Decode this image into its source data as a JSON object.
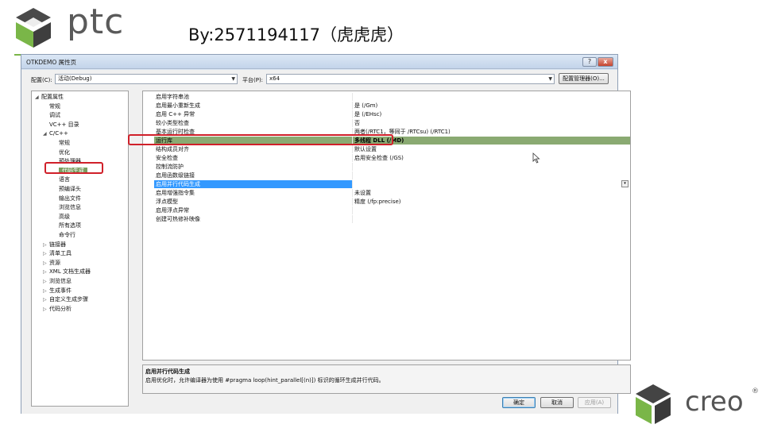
{
  "slide": {
    "byline": "By:2571194117（虎虎虎）",
    "brand_top": "ptc",
    "brand_bottom": "creo",
    "brand_bottom_mark": "®"
  },
  "window": {
    "title": "OTKDEMO 属性页",
    "help_label": "?",
    "close_label": "x"
  },
  "toolbar": {
    "config_label": "配置(C):",
    "config_value": "活动(Debug)",
    "platform_label": "平台(P):",
    "platform_value": "x64",
    "config_manager_label": "配置管理器(O)..."
  },
  "tree": {
    "items": [
      {
        "label": "配置属性",
        "toggle": "◢",
        "level": 0
      },
      {
        "label": "常规",
        "toggle": "",
        "level": 1
      },
      {
        "label": "调试",
        "toggle": "",
        "level": 1
      },
      {
        "label": "VC++ 目录",
        "toggle": "",
        "level": 1
      },
      {
        "label": "C/C++",
        "toggle": "◢",
        "level": 1
      },
      {
        "label": "常规",
        "toggle": "",
        "level": 2
      },
      {
        "label": "优化",
        "toggle": "",
        "level": 2
      },
      {
        "label": "预处理器",
        "toggle": "",
        "level": 2
      },
      {
        "label": "代码生成",
        "toggle": "",
        "level": 2
      },
      {
        "label": "语言",
        "toggle": "",
        "level": 2
      },
      {
        "label": "预编译头",
        "toggle": "",
        "level": 2
      },
      {
        "label": "输出文件",
        "toggle": "",
        "level": 2
      },
      {
        "label": "浏览信息",
        "toggle": "",
        "level": 2
      },
      {
        "label": "高级",
        "toggle": "",
        "level": 2
      },
      {
        "label": "所有选项",
        "toggle": "",
        "level": 2
      },
      {
        "label": "命令行",
        "toggle": "",
        "level": 2
      },
      {
        "label": "链接器",
        "toggle": "▷",
        "level": 1
      },
      {
        "label": "清单工具",
        "toggle": "▷",
        "level": 1
      },
      {
        "label": "资源",
        "toggle": "▷",
        "level": 1
      },
      {
        "label": "XML 文档生成器",
        "toggle": "▷",
        "level": 1
      },
      {
        "label": "浏览信息",
        "toggle": "▷",
        "level": 1
      },
      {
        "label": "生成事件",
        "toggle": "▷",
        "level": 1
      },
      {
        "label": "自定义生成步骤",
        "toggle": "▷",
        "level": 1
      },
      {
        "label": "代码分析",
        "toggle": "▷",
        "level": 1
      }
    ]
  },
  "properties": {
    "rows": [
      {
        "name": "启用字符串池",
        "value": ""
      },
      {
        "name": "启用最小重新生成",
        "value": "是 (/Gm)"
      },
      {
        "name": "启用 C++ 异常",
        "value": "是 (/EHsc)"
      },
      {
        "name": "较小类型检查",
        "value": "否"
      },
      {
        "name": "基本运行时检查",
        "value": "两者(/RTC1，等同于 /RTCsu) (/RTC1)"
      },
      {
        "name": "运行库",
        "value": "多线程 DLL (/MD)"
      },
      {
        "name": "结构成员对齐",
        "value": "默认设置"
      },
      {
        "name": "安全检查",
        "value": "启用安全检查 (/GS)"
      },
      {
        "name": "控制流防护",
        "value": ""
      },
      {
        "name": "启用函数级链接",
        "value": ""
      },
      {
        "name": "启用并行代码生成",
        "value": ""
      },
      {
        "name": "启用增强指令集",
        "value": "未设置"
      },
      {
        "name": "浮点模型",
        "value": "精度 (/fp:precise)"
      },
      {
        "name": "启用浮点异常",
        "value": ""
      },
      {
        "name": "创建可热修补映像",
        "value": ""
      }
    ],
    "dropdown_glyph": "▾"
  },
  "description": {
    "title": "启用并行代码生成",
    "text": "启用优化时，允许编译器为使用 #pragma loop(hint_parallel[(n)]) 标识的循环生成并行代码。"
  },
  "buttons": {
    "ok": "确定",
    "cancel": "取消",
    "apply": "应用(A)"
  },
  "colors": {
    "highlight_border": "#d0202a",
    "row_green": "#8aaa72",
    "selection_blue": "#3399ff",
    "brand_green": "#7ab648"
  }
}
